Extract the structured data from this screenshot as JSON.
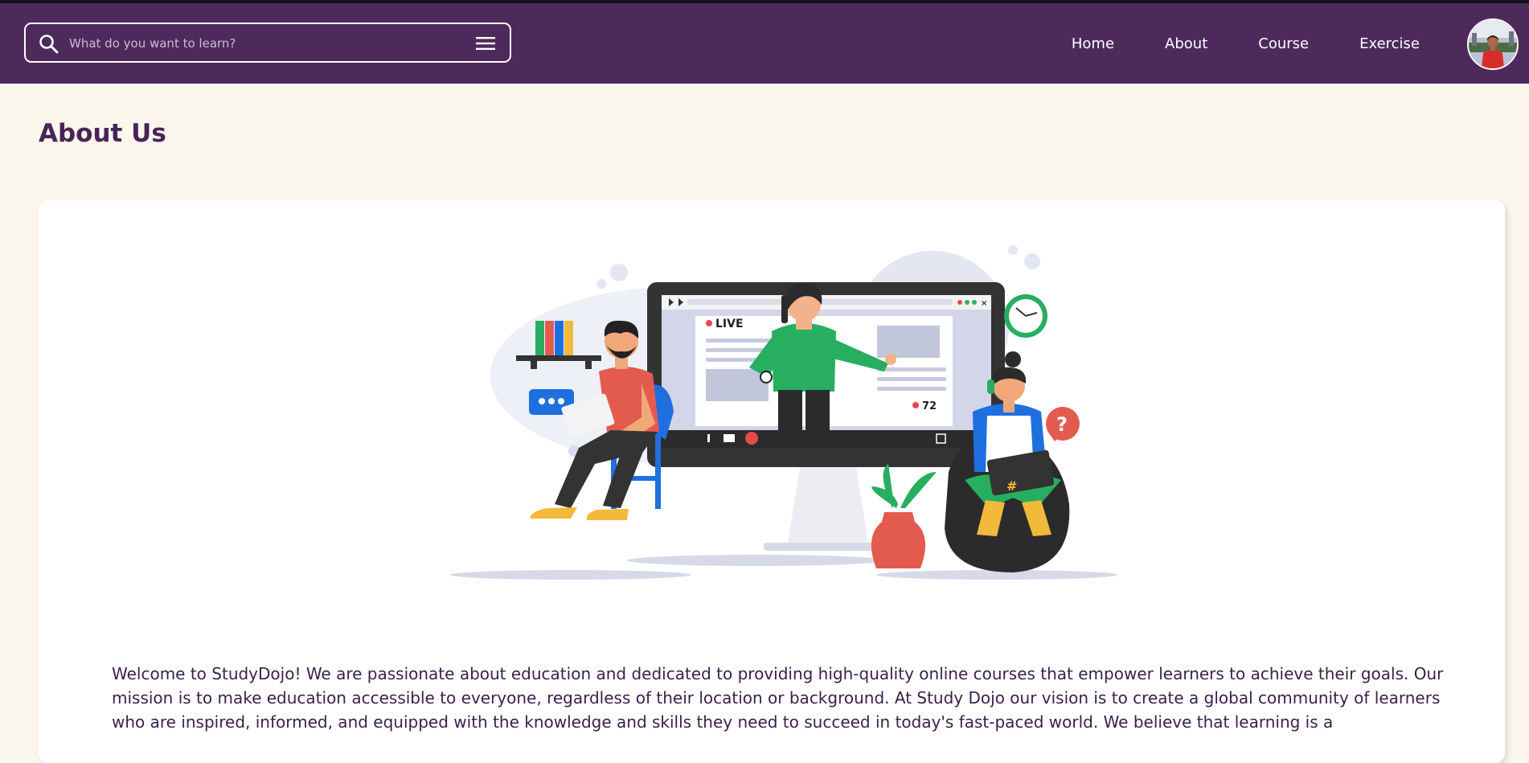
{
  "header": {
    "search": {
      "placeholder": "What do you want to learn?",
      "value": ""
    },
    "nav": [
      {
        "label": "Home"
      },
      {
        "label": "About"
      },
      {
        "label": "Course"
      },
      {
        "label": "Exercise"
      }
    ]
  },
  "page": {
    "title": "About Us",
    "illustration": {
      "live_label": "LIVE",
      "viewer_count": "72"
    },
    "body_text": "Welcome to StudyDojo! We are passionate about education and dedicated to providing high-quality online courses that empower learners to achieve their goals. Our mission is to make education accessible to everyone, regardless of their location or background. At Study Dojo our vision is to create a global community of learners who are inspired, informed, and equipped with the knowledge and skills they need to succeed in today's fast-paced world. We believe that learning is a"
  },
  "colors": {
    "nav_background": "#4e2a5c",
    "page_background": "#fbf6ec",
    "heading": "#4a2358",
    "accent_green": "#27ae60",
    "accent_blue": "#1e6fe0"
  }
}
